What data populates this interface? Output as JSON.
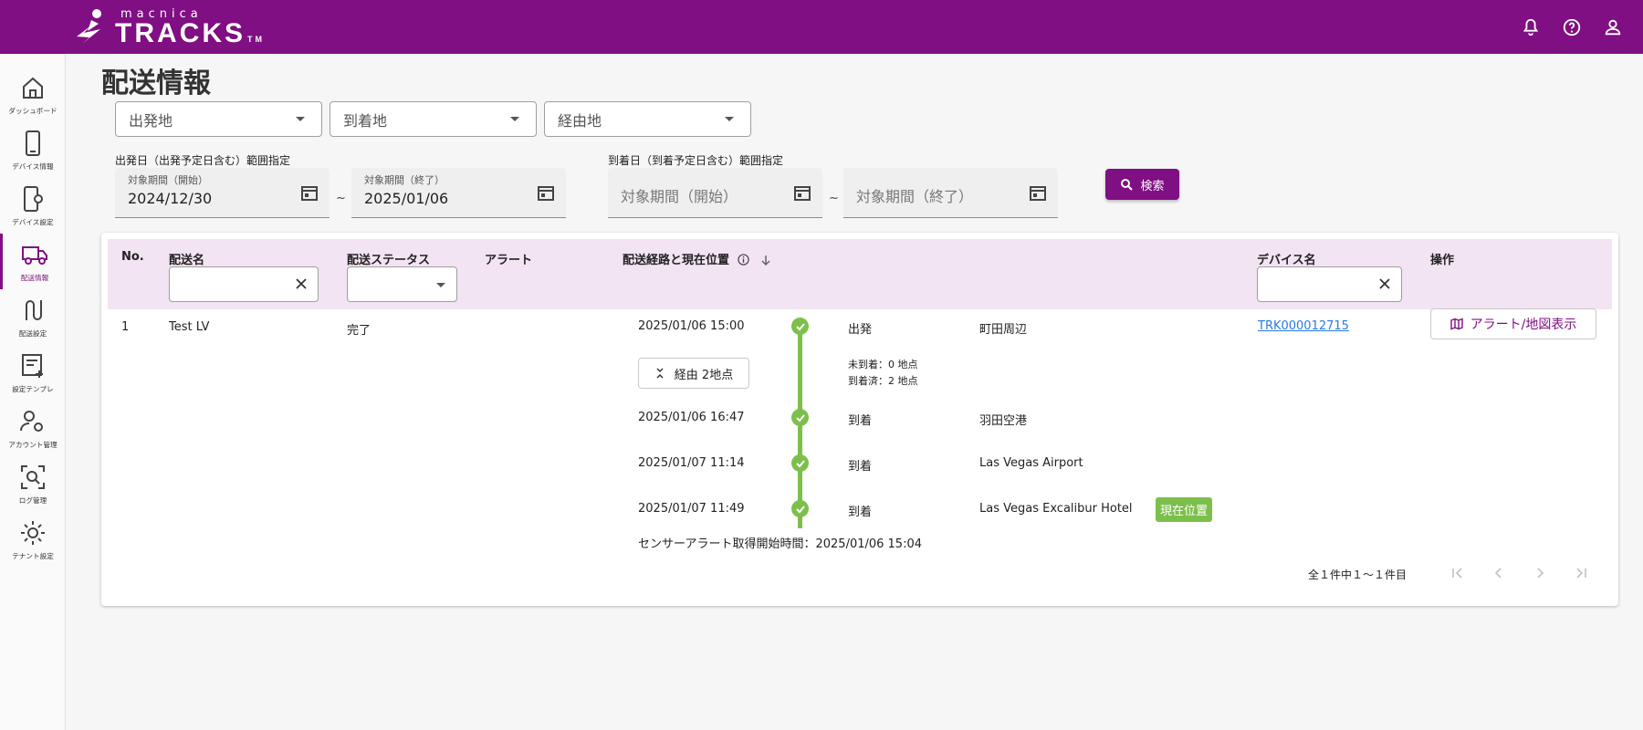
{
  "brand": {
    "small": "macnica",
    "big": "TRACKS",
    "tm": "TM"
  },
  "header_icons": [
    "bell-icon",
    "help-icon",
    "account-icon"
  ],
  "sidebar": {
    "items": [
      {
        "label": "ダッシュボード",
        "icon": "home-icon",
        "active": false
      },
      {
        "label": "デバイス情報",
        "icon": "phone-icon",
        "active": false
      },
      {
        "label": "デバイス設定",
        "icon": "device-settings-icon",
        "active": false
      },
      {
        "label": "配送情報",
        "icon": "truck-icon",
        "active": true
      },
      {
        "label": "配送設定",
        "icon": "route-icon",
        "active": false
      },
      {
        "label": "設定テンプレ",
        "icon": "template-icon",
        "active": false
      },
      {
        "label": "アカウント管理",
        "icon": "account-settings-icon",
        "active": false
      },
      {
        "label": "ログ管理",
        "icon": "log-search-icon",
        "active": false
      },
      {
        "label": "テナント設定",
        "icon": "gear-icon",
        "active": false
      }
    ]
  },
  "page": {
    "title": "配送情報"
  },
  "filters": {
    "origin_placeholder": "出発地",
    "destination_placeholder": "到着地",
    "via_placeholder": "経由地",
    "departure_range_label": "出発日（出発予定日含む）範囲指定",
    "arrival_range_label": "到着日（到着予定日含む）範囲指定",
    "departure_start_label": "対象期間（開始）",
    "departure_start_value": "2024/12/30",
    "departure_end_label": "対象期間（終了）",
    "departure_end_value": "2025/01/06",
    "arrival_start_placeholder": "対象期間（開始）",
    "arrival_end_placeholder": "対象期間（終了）",
    "tilde": "~",
    "search_label": "検索"
  },
  "table": {
    "headers": {
      "no": "No.",
      "name": "配送名",
      "status": "配送ステータス",
      "alert": "アラート",
      "route": "配送経路と現在位置",
      "device": "デバイス名",
      "action": "操作"
    },
    "row": {
      "no": "1",
      "name": "Test LV",
      "status": "完了",
      "via_button": "経由 2地点",
      "not_arrived": "未到着：0 地点",
      "arrived": "到着済：2 地点",
      "events": [
        {
          "time": "2025/01/06 15:00",
          "type": "出発",
          "place": "町田周辺"
        },
        {
          "time": "2025/01/06 16:47",
          "type": "到着",
          "place": "羽田空港"
        },
        {
          "time": "2025/01/07 11:14",
          "type": "到着",
          "place": "Las Vegas Airport"
        },
        {
          "time": "2025/01/07 11:49",
          "type": "到着",
          "place": "Las Vegas Excalibur Hotel"
        }
      ],
      "current_badge": "現在位置",
      "sensor_note": "センサーアラート取得開始時間：2025/01/06 15:04",
      "device": "TRK000012715",
      "action_button": "アラート/地図表示"
    },
    "pagination": {
      "text": "全１件中１～１件目"
    }
  },
  "colors": {
    "brand": "#7f0f82",
    "header_row": "#f2e4f2",
    "timeline": "#7cc04b",
    "link": "#2a7ae2"
  }
}
